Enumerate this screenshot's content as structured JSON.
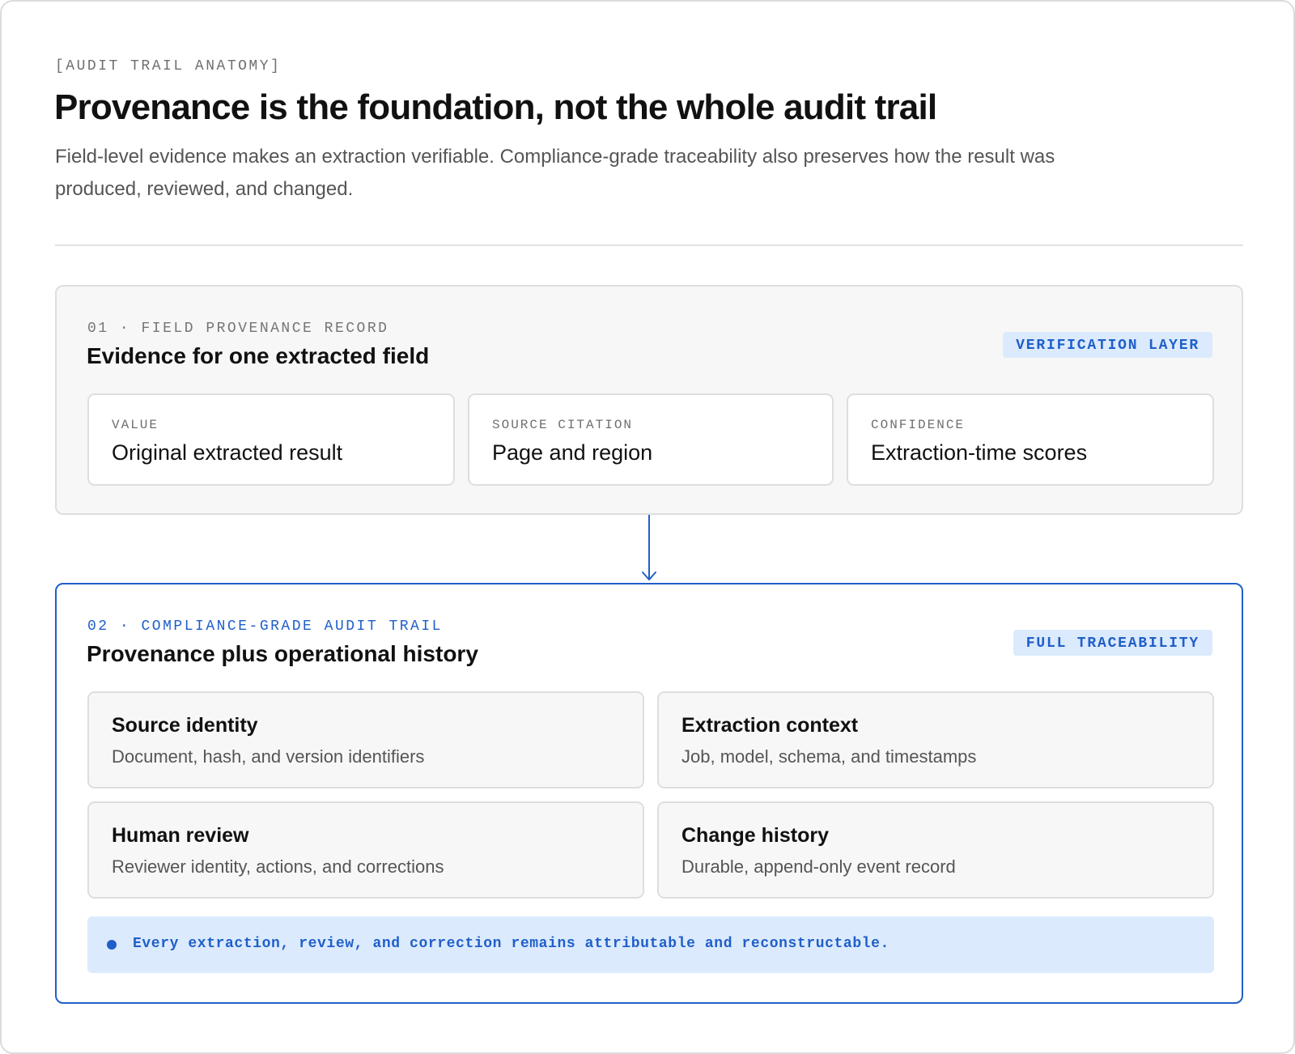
{
  "header": {
    "eyebrow": "[AUDIT TRAIL ANATOMY]",
    "title": "Provenance is the foundation, not the whole audit trail",
    "subtitle": "Field-level evidence makes an extraction verifiable. Compliance-grade traceability also preserves how the result was produced, reviewed, and changed."
  },
  "layer1": {
    "eyebrow": "01 · FIELD PROVENANCE RECORD",
    "title": "Evidence for one extracted field",
    "tag": "VERIFICATION LAYER",
    "fields": [
      {
        "label": "VALUE",
        "value": "Original extracted result"
      },
      {
        "label": "SOURCE CITATION",
        "value": "Page and region"
      },
      {
        "label": "CONFIDENCE",
        "value": "Extraction-time scores"
      }
    ]
  },
  "connector": {
    "icon": "arrow-down-icon",
    "color": "#1f5fc9"
  },
  "layer2": {
    "eyebrow": "02 · COMPLIANCE-GRADE AUDIT TRAIL",
    "title": "Provenance plus operational history",
    "tag": "FULL TRACEABILITY",
    "cards": [
      {
        "title": "Source identity",
        "desc": "Document, hash, and version identifiers"
      },
      {
        "title": "Extraction context",
        "desc": "Job, model, schema, and timestamps"
      },
      {
        "title": "Human review",
        "desc": "Reviewer identity, actions, and corrections"
      },
      {
        "title": "Change history",
        "desc": "Durable, append-only event record"
      }
    ],
    "note": "Every extraction, review, and correction remains attributable and reconstructable."
  },
  "colors": {
    "accent": "#1f5fc9",
    "accent_tint": "#dceafd",
    "muted_text": "#555555",
    "card_bg": "#f7f7f7"
  }
}
